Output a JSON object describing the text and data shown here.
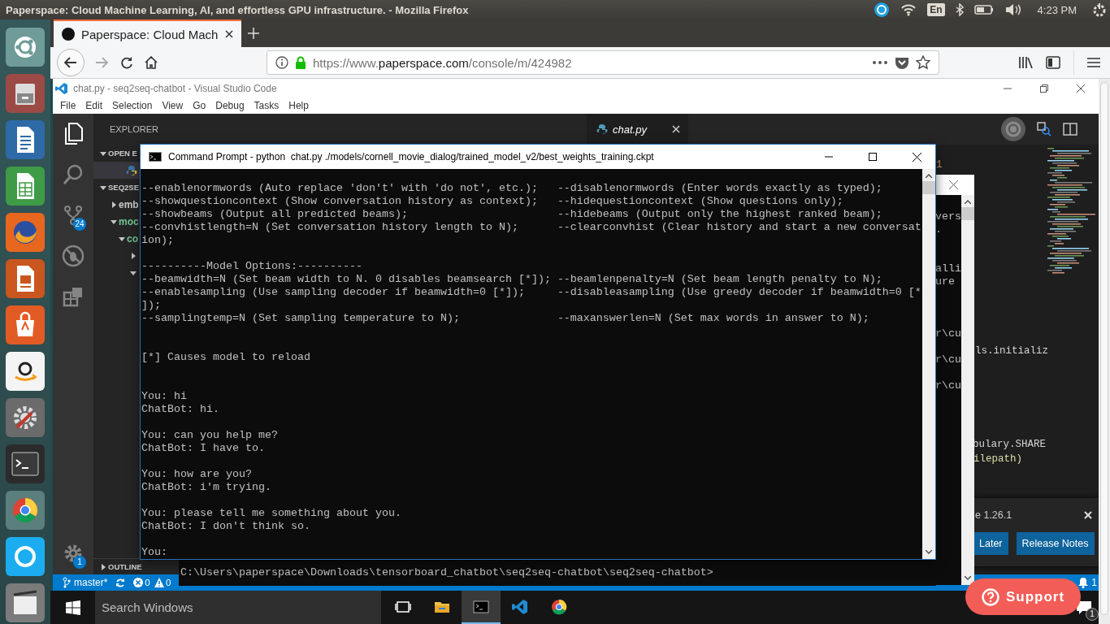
{
  "top_bar": {
    "window_title": "Paperspace: Cloud Machine Learning, AI, and effortless GPU infrastructure. - Mozilla Firefox",
    "keyboard_layout": "En",
    "clock": "4:23 PM"
  },
  "browser": {
    "tabs": [
      {
        "title": "Paperspace: Cloud Mach",
        "selected": true
      }
    ],
    "url": {
      "prefix": "https://www.",
      "domain": "paperspace.com",
      "path": "/console/m/424982"
    }
  },
  "vscode": {
    "title": "chat.py - seq2seq-chatbot - Visual Studio Code",
    "menu": [
      "File",
      "Edit",
      "Selection",
      "View",
      "Go",
      "Debug",
      "Tasks",
      "Help"
    ],
    "source_control_badge": "24",
    "settings_badge": "1",
    "sidebar": {
      "title": "EXPLORER",
      "open_editors": {
        "label": "OPEN E",
        "expanded": true,
        "items": [
          {
            "selected": true
          }
        ]
      },
      "folder": {
        "label": "SEQ2SE",
        "expanded": true,
        "children": [
          {
            "label": "emb",
            "expanded": false
          },
          {
            "label": "moc",
            "expanded": true,
            "color": "#73c991",
            "children": [
              {
                "label": "co",
                "expanded": true,
                "color": "#73c991",
                "children": [
                  {
                    "expanded": false
                  },
                  {
                    "expanded": true
                  }
                ]
              }
            ]
          }
        ]
      },
      "outline": {
        "label": "OUTLINE",
        "expanded": false
      }
    },
    "editor": {
      "tabs": [
        {
          "label": "chat.py",
          "selected": true
        }
      ],
      "code_fragments": [
        {
          "text": "1"
        },
        {
          "text": "ls.initializ"
        },
        {
          "text": "bulary.SHARE"
        },
        {
          "text": "ilepath)"
        }
      ],
      "notification": {
        "message": "e 1.26.1",
        "buttons": [
          "Later",
          "Release Notes"
        ]
      }
    },
    "status_bar": {
      "branch": "master*",
      "errors": "0",
      "warnings": "0",
      "notifications": "1"
    }
  },
  "command_prompt": {
    "title": "Command Prompt - python  chat.py ./models/cornell_movie_dialog/trained_model_v2/best_weights_training.ckpt",
    "lines": [
      {
        "kind": "options",
        "left": "--enablenormwords (Auto replace 'don't' with 'do not', etc.);",
        "right": "--disablenormwords (Enter words exactly as typed);"
      },
      {
        "kind": "options",
        "left": "--showquestioncontext (Show conversation history as context);",
        "right": "--hidequestioncontext (Show questions only);"
      },
      {
        "kind": "options",
        "left": "--showbeams (Output all predicted beams);",
        "right": "--hidebeams (Output only the highest ranked beam);"
      },
      {
        "kind": "options",
        "left": "--convhistlength=N (Set conversation history length to N);",
        "right": "--clearconvhist (Clear history and start a new conversat"
      },
      {
        "kind": "text",
        "text": "ion);"
      },
      {
        "kind": "blank"
      },
      {
        "kind": "text",
        "text": "----------Model Options:----------"
      },
      {
        "kind": "options",
        "left": "--beamwidth=N (Set beam width to N. 0 disables beamsearch [*]);",
        "right": "--beamlenpenalty=N (Set beam length penalty to N);"
      },
      {
        "kind": "options",
        "left": "--enablesampling (Use sampling decoder if beamwidth=0 [*]);",
        "right": "--disableasampling (Use greedy decoder if beamwidth=0 [*"
      },
      {
        "kind": "text",
        "text": "]);"
      },
      {
        "kind": "options",
        "left": "--samplingtemp=N (Set sampling temperature to N);",
        "right": "--maxanswerlen=N (Set max words in answer to N);"
      },
      {
        "kind": "blank"
      },
      {
        "kind": "blank"
      },
      {
        "kind": "text",
        "text": "[*] Causes model to reload"
      },
      {
        "kind": "blank"
      },
      {
        "kind": "blank"
      },
      {
        "kind": "text",
        "text": "You: hi"
      },
      {
        "kind": "text",
        "text": "ChatBot: hi."
      },
      {
        "kind": "blank"
      },
      {
        "kind": "text",
        "text": "You: can you help me?"
      },
      {
        "kind": "text",
        "text": "ChatBot: I have to."
      },
      {
        "kind": "blank"
      },
      {
        "kind": "text",
        "text": "You: how are you?"
      },
      {
        "kind": "text",
        "text": "ChatBot: i'm trying."
      },
      {
        "kind": "blank"
      },
      {
        "kind": "text",
        "text": "You: please tell me something about you."
      },
      {
        "kind": "text",
        "text": "ChatBot: I don't think so."
      },
      {
        "kind": "blank"
      },
      {
        "kind": "text",
        "text": "You:"
      }
    ]
  },
  "background_console": {
    "lines": [
      {
        "kind": "text",
        "text": "vers"
      },
      {
        "kind": "text",
        "text": "."
      },
      {
        "kind": "blank"
      },
      {
        "kind": "blank"
      },
      {
        "kind": "text",
        "text": "alli"
      },
      {
        "kind": "text",
        "text": "ure"
      },
      {
        "kind": "blank"
      },
      {
        "kind": "blank"
      },
      {
        "kind": "blank"
      },
      {
        "kind": "text",
        "text": "r\\cu"
      },
      {
        "kind": "blank"
      },
      {
        "kind": "text",
        "text": "r\\cu"
      },
      {
        "kind": "blank"
      },
      {
        "kind": "text",
        "text": "r\\cu"
      }
    ]
  },
  "bottom_console": {
    "prompt": "C:\\Users\\paperspace\\Downloads\\tensorboard_chatbot\\seq2seq-chatbot\\seq2seq-chatbot>"
  },
  "taskbar": {
    "search": {
      "placeholder": "Search Windows"
    },
    "apps": [
      {
        "selected": false
      },
      {
        "selected": false
      },
      {
        "selected": true
      },
      {
        "selected": false
      },
      {
        "selected": false
      }
    ],
    "notification_count": "1"
  },
  "support_button": {
    "label": "Support"
  }
}
